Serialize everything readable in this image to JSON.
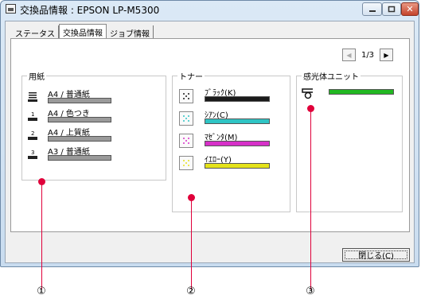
{
  "window": {
    "title": "交換品情報 : EPSON LP-M5300",
    "close_glyph": "✕"
  },
  "tabs": [
    {
      "label": "ステータス",
      "active": false
    },
    {
      "label": "交換品情報",
      "active": true
    },
    {
      "label": "ジョブ情報",
      "active": false
    }
  ],
  "pager": {
    "prev_glyph": "◀",
    "next_glyph": "▶",
    "index": "1/3"
  },
  "paper": {
    "title": "用紙",
    "items": [
      {
        "label": "A4 / 普通紙",
        "level": 1.0,
        "icon": "paper-tray-full-icon"
      },
      {
        "label": "A4 / 色つき",
        "level": 1.0,
        "icon": "paper-tray-1-icon"
      },
      {
        "label": "A4 / 上質紙",
        "level": 1.0,
        "icon": "paper-tray-2-icon"
      },
      {
        "label": "A3 / 普通紙",
        "level": 1.0,
        "icon": "paper-tray-3-icon"
      }
    ]
  },
  "toner": {
    "title": "トナー",
    "items": [
      {
        "label": "ﾌﾞﾗｯｸ(K)",
        "level": 1.0,
        "color": "#1a1a1a"
      },
      {
        "label": "ｼｱﾝ(C)",
        "level": 1.0,
        "color": "#2fc4c4"
      },
      {
        "label": "ﾏｾﾞﾝﾀ(M)",
        "level": 1.0,
        "color": "#d630c8"
      },
      {
        "label": "ｲｴﾛｰ(Y)",
        "level": 1.0,
        "color": "#e4e21a"
      }
    ]
  },
  "drum": {
    "title": "感光体ユニット",
    "level": 1.0,
    "color": "#22b822"
  },
  "close_button": {
    "label": "閉じる(C)"
  },
  "callouts": [
    {
      "label": "①"
    },
    {
      "label": "②"
    },
    {
      "label": "③"
    }
  ],
  "colors": {
    "callout": "#e0003a",
    "paper_bar": "#9a9a9a"
  }
}
